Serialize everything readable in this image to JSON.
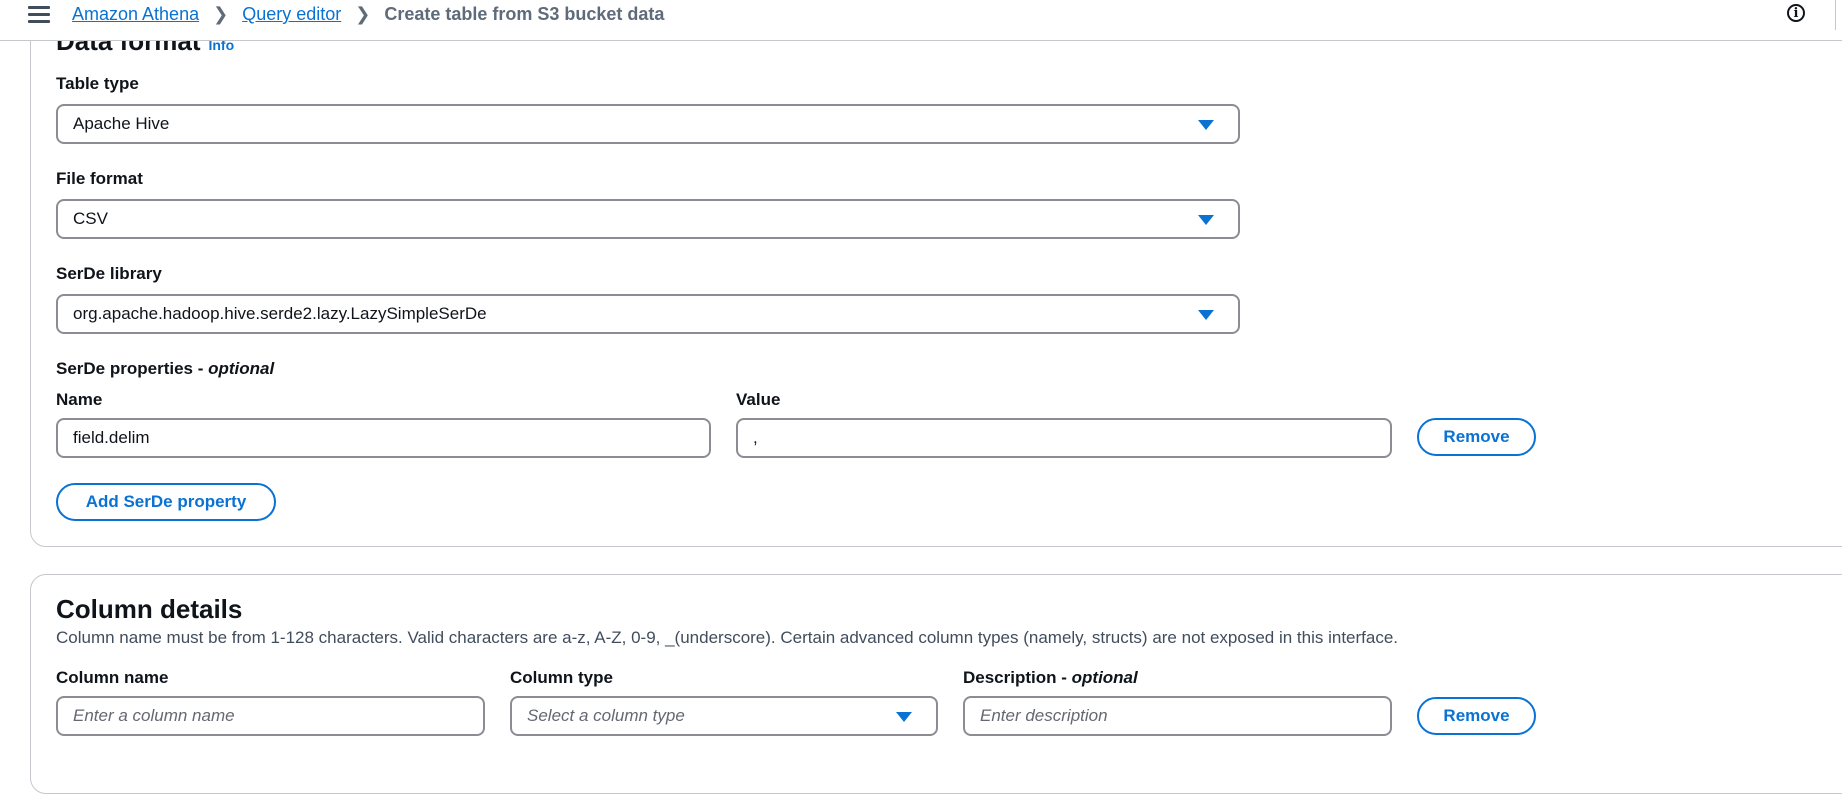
{
  "breadcrumbs": {
    "items": [
      "Amazon Athena",
      "Query editor"
    ],
    "current": "Create table from S3 bucket data"
  },
  "data_format": {
    "title": "Data format",
    "info": "Info",
    "table_type": {
      "label": "Table type",
      "value": "Apache Hive"
    },
    "file_format": {
      "label": "File format",
      "value": "CSV"
    },
    "serde_library": {
      "label": "SerDe library",
      "value": "org.apache.hadoop.hive.serde2.lazy.LazySimpleSerDe"
    },
    "serde_properties": {
      "label": "SerDe properties",
      "optional": "optional",
      "name_label": "Name",
      "value_label": "Value",
      "rows": [
        {
          "name": "field.delim",
          "value": ","
        }
      ],
      "remove_label": "Remove",
      "add_label": "Add SerDe property"
    }
  },
  "column_details": {
    "title": "Column details",
    "description": "Column name must be from 1-128 characters. Valid characters are a-z, A-Z, 0-9, _(underscore). Certain advanced column types (namely, structs) are not exposed in this interface.",
    "column_name": {
      "label": "Column name",
      "placeholder": "Enter a column name"
    },
    "column_type": {
      "label": "Column type",
      "placeholder": "Select a column type"
    },
    "description_field": {
      "label": "Description",
      "optional": "optional",
      "placeholder": "Enter description"
    },
    "remove_label": "Remove"
  },
  "colors": {
    "accent": "#0972d3",
    "text": "#0f141a",
    "border": "#8c8c94"
  }
}
